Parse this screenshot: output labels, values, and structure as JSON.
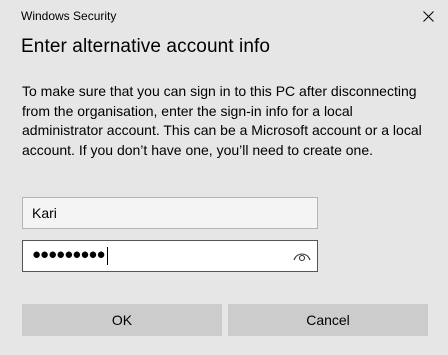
{
  "window": {
    "app_title": "Windows Security",
    "close_icon": "close-icon"
  },
  "dialog": {
    "heading": "Enter alternative account info",
    "description": "To make sure that you can sign in to this PC after disconnecting from the organisation, enter the sign-in info for a local administrator account. This can be a Microsoft account or a local account. If you don’t have one, you’ll need to create one."
  },
  "form": {
    "username_value": "Kari",
    "password_masked": "●●●●●●●●●",
    "reveal_icon": "eye-icon"
  },
  "buttons": {
    "ok_label": "OK",
    "cancel_label": "Cancel"
  },
  "colors": {
    "background": "#e6e6e6",
    "button": "#cccccc"
  }
}
